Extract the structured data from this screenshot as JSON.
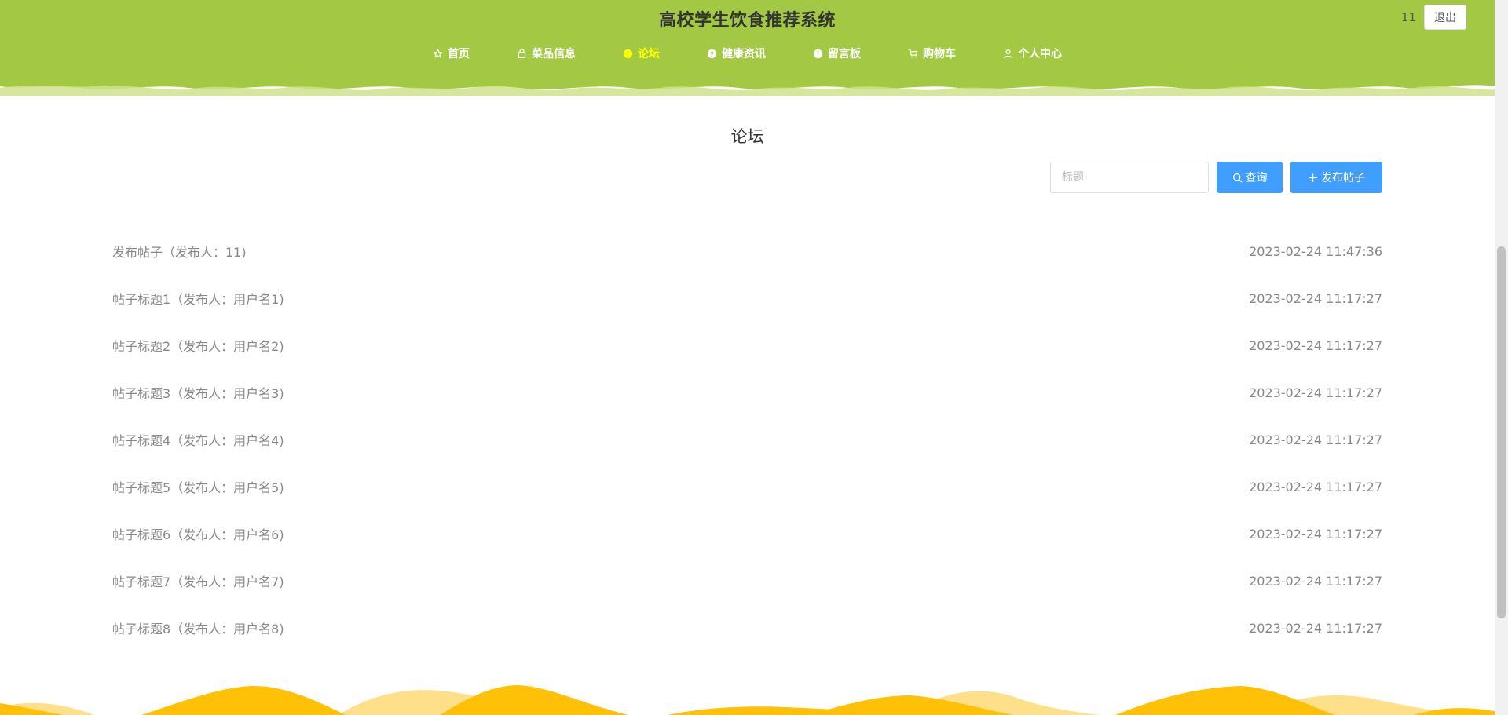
{
  "header": {
    "site_title": "高校学生饮食推荐系统",
    "username": "11",
    "logout_label": "退出",
    "bg_color": "#a3c944",
    "nav": [
      {
        "label": "首页",
        "icon": "star-icon",
        "active": false
      },
      {
        "label": "菜品信息",
        "icon": "shop-icon",
        "active": false
      },
      {
        "label": "论坛",
        "icon": "info-circle-icon",
        "active": true
      },
      {
        "label": "健康资讯",
        "icon": "question-circle-icon",
        "active": false
      },
      {
        "label": "留言板",
        "icon": "info-circle-icon",
        "active": false
      },
      {
        "label": "购物车",
        "icon": "cart-icon",
        "active": false
      },
      {
        "label": "个人中心",
        "icon": "user-icon",
        "active": false
      }
    ]
  },
  "main": {
    "page_title": "论坛",
    "search_placeholder": "标题",
    "search_label": "查询",
    "post_label": "发布帖子",
    "posts": [
      {
        "title": "发布帖子（发布人：11)",
        "time": "2023-02-24 11:47:36"
      },
      {
        "title": "帖子标题1（发布人：用户名1)",
        "time": "2023-02-24 11:17:27"
      },
      {
        "title": "帖子标题2（发布人：用户名2)",
        "time": "2023-02-24 11:17:27"
      },
      {
        "title": "帖子标题3（发布人：用户名3)",
        "time": "2023-02-24 11:17:27"
      },
      {
        "title": "帖子标题4（发布人：用户名4)",
        "time": "2023-02-24 11:17:27"
      },
      {
        "title": "帖子标题5（发布人：用户名5)",
        "time": "2023-02-24 11:17:27"
      },
      {
        "title": "帖子标题6（发布人：用户名6)",
        "time": "2023-02-24 11:17:27"
      },
      {
        "title": "帖子标题7（发布人：用户名7)",
        "time": "2023-02-24 11:17:27"
      },
      {
        "title": "帖子标题8（发布人：用户名8)",
        "time": "2023-02-24 11:17:27"
      }
    ]
  },
  "colors": {
    "primary": "#409eff",
    "nav_active": "#ffff00",
    "footer_wave": "#ffc107"
  }
}
